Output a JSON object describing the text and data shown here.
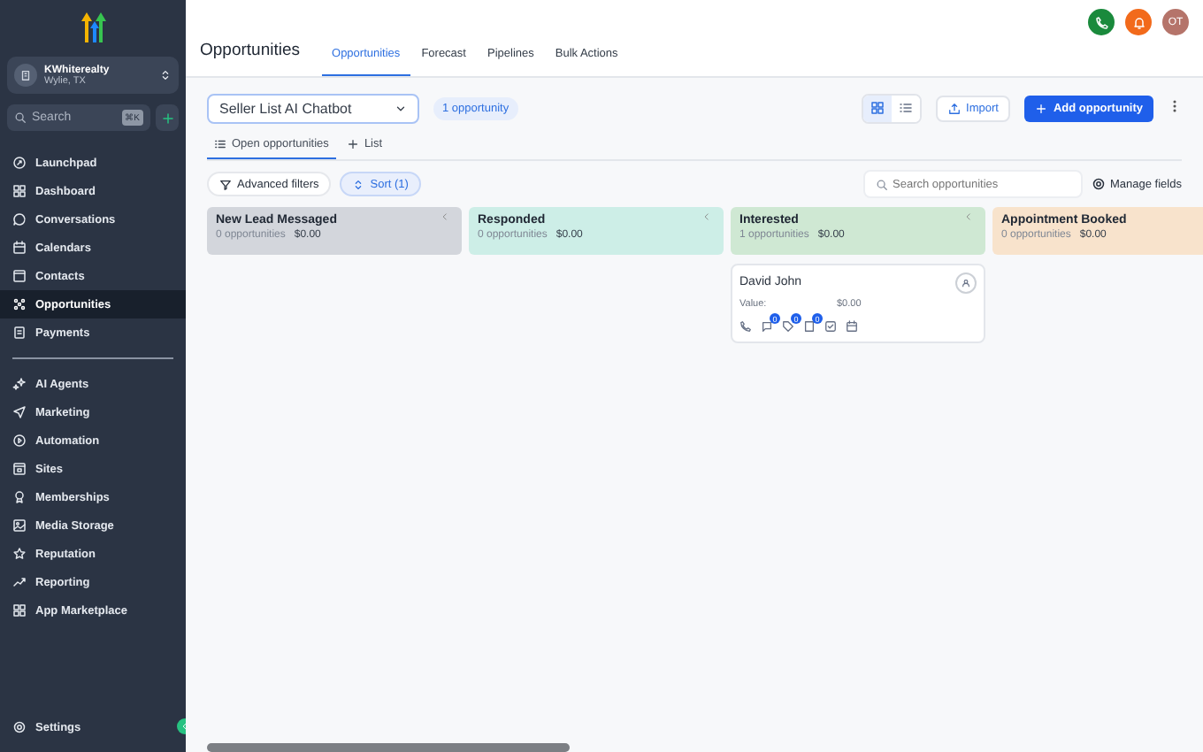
{
  "sidebar": {
    "account": {
      "name": "KWhiterealty",
      "location": "Wylie, TX"
    },
    "search": {
      "placeholder": "Search",
      "shortcut": "⌘K"
    },
    "items": [
      {
        "label": "Launchpad",
        "selected": false
      },
      {
        "label": "Dashboard",
        "selected": false
      },
      {
        "label": "Conversations",
        "selected": false
      },
      {
        "label": "Calendars",
        "selected": false
      },
      {
        "label": "Contacts",
        "selected": false
      },
      {
        "label": "Opportunities",
        "selected": true
      },
      {
        "label": "Payments",
        "selected": false
      }
    ],
    "items2": [
      {
        "label": "AI Agents",
        "selected": false
      },
      {
        "label": "Marketing",
        "selected": false
      },
      {
        "label": "Automation",
        "selected": false
      },
      {
        "label": "Sites",
        "selected": false
      },
      {
        "label": "Memberships",
        "selected": false
      },
      {
        "label": "Media Storage",
        "selected": false
      },
      {
        "label": "Reputation",
        "selected": false
      },
      {
        "label": "Reporting",
        "selected": false
      },
      {
        "label": "App Marketplace",
        "selected": false
      }
    ],
    "settings": "Settings"
  },
  "header": {
    "title": "Opportunities",
    "tabs": [
      {
        "label": "Opportunities",
        "selected": true
      },
      {
        "label": "Forecast",
        "selected": false
      },
      {
        "label": "Pipelines",
        "selected": false
      },
      {
        "label": "Bulk Actions",
        "selected": false
      }
    ],
    "avatar": "OT"
  },
  "toolbar": {
    "pipeline": "Seller List AI Chatbot",
    "count": "1 opportunity",
    "views": [
      {
        "kind": "grid",
        "selected": true
      },
      {
        "kind": "list",
        "selected": false
      }
    ],
    "import": "Import",
    "add": "Add opportunity"
  },
  "view_tabs": [
    {
      "label": "Open opportunities",
      "selected": true
    },
    {
      "label": "List",
      "selected": false
    }
  ],
  "filters": {
    "advanced": "Advanced filters",
    "sort": "Sort (1)",
    "search_placeholder": "Search opportunities",
    "manage": "Manage fields"
  },
  "stages": [
    {
      "name": "New Lead Messaged",
      "count": "0 opportunities",
      "value": "$0.00",
      "color": "#d3d6dc"
    },
    {
      "name": "Responded",
      "count": "0 opportunities",
      "value": "$0.00",
      "color": "#cdeee7"
    },
    {
      "name": "Interested",
      "count": "1 opportunities",
      "value": "$0.00",
      "color": "#cfe8d3",
      "cards": [
        {
          "name": "David John",
          "value_label": "Value:",
          "value": "$0.00",
          "badges": [
            "0",
            "0",
            "0"
          ]
        }
      ]
    },
    {
      "name": "Appointment Booked",
      "count": "0 opportunities",
      "value": "$0.00",
      "color": "#f8e3cc"
    }
  ]
}
